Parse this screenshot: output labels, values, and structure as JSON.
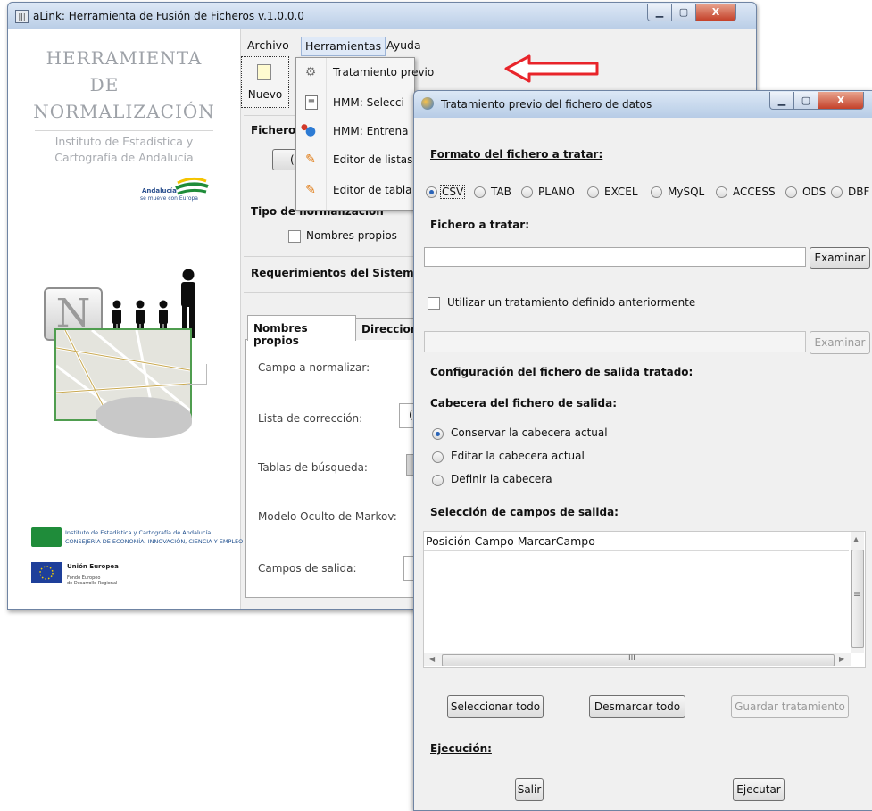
{
  "main_window": {
    "title": "aLink: Herramienta de Fusión de Ficheros v.1.0.0.0",
    "controls": {
      "minimize": "▁",
      "maximize": "▢",
      "close": "X"
    },
    "left_panel": {
      "brand_lines": [
        "HERRAMIENTA",
        "DE",
        "NORMALIZACIÓN"
      ],
      "institute_lines": [
        "Instituto de Estadística y",
        "Cartografía de Andalucía"
      ],
      "andalucia_logo": [
        "Andalucía",
        "se mueve con Europa"
      ],
      "n_letter": "N",
      "footer_inst": [
        "Instituto de Estadística y Cartografía de Andalucía",
        "CONSEJERÍA DE ECONOMÍA, INNOVACIÓN, CIENCIA Y EMPLEO"
      ],
      "footer_eu": [
        "Unión Europea",
        "Fondo Europeo",
        "de Desarrollo Regional"
      ]
    },
    "menubar": [
      "Archivo",
      "Herramientas",
      "Ayuda"
    ],
    "toolbar": {
      "nuevo_label": "Nuevo"
    },
    "fichero": {
      "label": "Fichero",
      "button_fragment": "(Ni"
    },
    "tipo": {
      "label": "Tipo de normalización",
      "checkbox_label": "Nombres propios"
    },
    "requerimientos": "Requerimientos del Sistema",
    "tabs": [
      "Nombres propios",
      "Direccion"
    ],
    "form_labels": [
      "Campo a normalizar:",
      "Lista de corrección:",
      "Tablas de búsqueda:",
      "Modelo Oculto de Markov:",
      "Campos de salida:"
    ],
    "form_fragment": "("
  },
  "menu_items": [
    {
      "label": "Tratamiento previo",
      "icon": "gears-icon"
    },
    {
      "label": "HMM: Selecci",
      "icon": "document-icon"
    },
    {
      "label": "HMM: Entrena",
      "icon": "molecule-icon"
    },
    {
      "label": "Editor de listas",
      "icon": "pencil-icon"
    },
    {
      "label": "Editor de tabla",
      "icon": "pencil-icon"
    }
  ],
  "annotation": {
    "arrow_color": "#e8242a"
  },
  "dialog": {
    "title": "Tratamiento previo del fichero de datos",
    "controls": {
      "minimize": "▁",
      "maximize": "▢",
      "close": "X"
    },
    "formato_heading": "Formato del fichero a tratar:",
    "formats": [
      {
        "label": "CSV",
        "selected": true
      },
      {
        "label": "TAB",
        "selected": false
      },
      {
        "label": "PLANO",
        "selected": false
      },
      {
        "label": "EXCEL",
        "selected": false
      },
      {
        "label": "MySQL",
        "selected": false
      },
      {
        "label": "ACCESS",
        "selected": false
      },
      {
        "label": "ODS",
        "selected": false
      },
      {
        "label": "DBF",
        "selected": false
      }
    ],
    "fichero_label": "Fichero a tratar:",
    "fichero_value": "",
    "examinar_label": "Examinar",
    "usar_tratamiento_label": "Utilizar un tratamiento definido anteriormente",
    "usar_tratamiento_checked": false,
    "tratamiento_value": "",
    "examinar2_label": "Examinar",
    "config_heading": "Configuración del fichero de salida tratado:",
    "cabecera_heading": "Cabecera del fichero de salida:",
    "cabecera_options": [
      {
        "label": "Conservar la cabecera actual",
        "selected": true
      },
      {
        "label": "Editar la cabecera actual",
        "selected": false
      },
      {
        "label": "Definir la cabecera",
        "selected": false
      }
    ],
    "seleccion_heading": "Selección de campos de salida:",
    "table_columns": "Posición Campo MarcarCampo",
    "hscroll_grip": "III",
    "vscroll_grip": "≡",
    "buttons": {
      "seleccionar": "Seleccionar todo",
      "desmarcar": "Desmarcar todo",
      "guardar": "Guardar tratamiento"
    },
    "ejecucion_heading": "Ejecución:",
    "salir_label": "Salir",
    "ejecutar_label": "Ejecutar"
  }
}
